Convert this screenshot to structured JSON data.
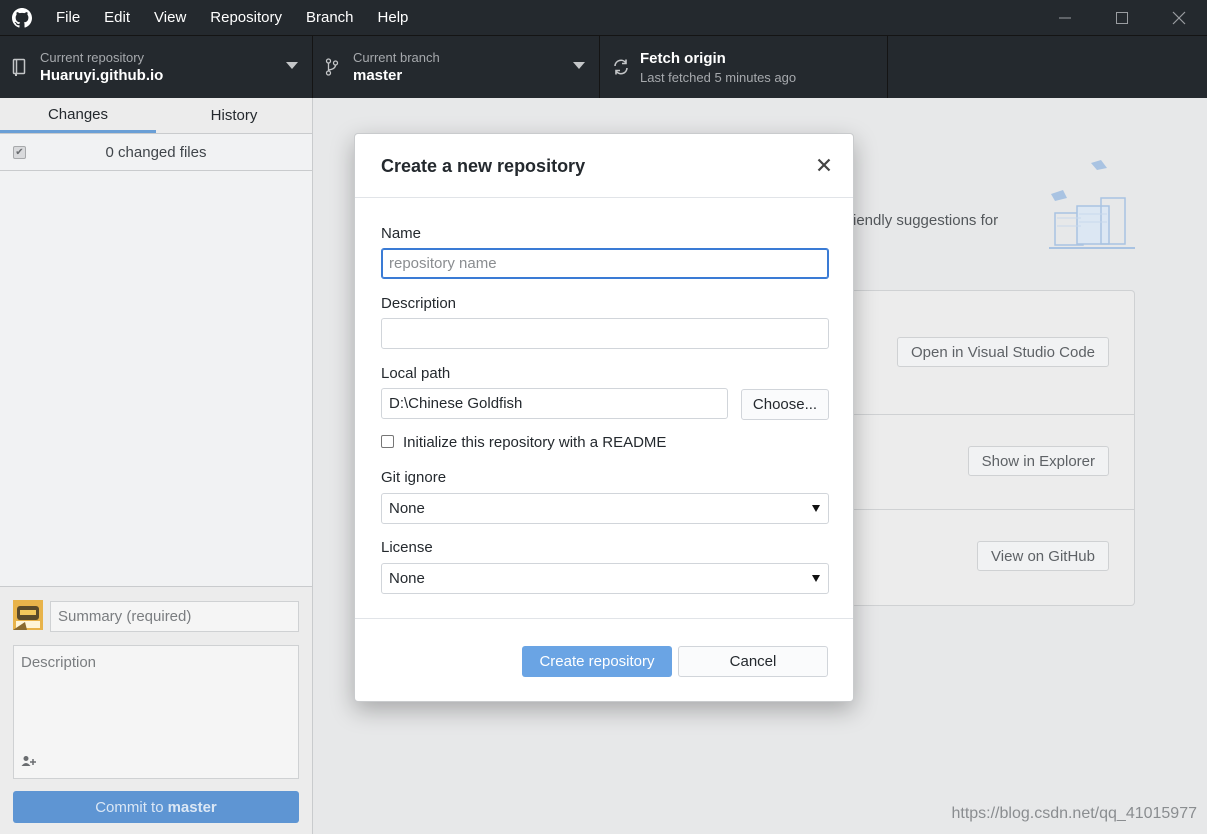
{
  "app": {
    "logo_icon": "github-octocat-icon"
  },
  "menu": [
    "File",
    "Edit",
    "View",
    "Repository",
    "Branch",
    "Help"
  ],
  "window_controls": {
    "minimize_icon": "minimize-icon",
    "maximize_icon": "maximize-icon",
    "close_icon": "close-icon"
  },
  "toolbar": {
    "repo": {
      "label": "Current repository",
      "value": "Huaruyi.github.io"
    },
    "branch": {
      "label": "Current branch",
      "value": "master"
    },
    "fetch": {
      "title": "Fetch origin",
      "subtitle": "Last fetched 5 minutes ago"
    }
  },
  "sidebar": {
    "tabs": [
      {
        "label": "Changes",
        "active": true
      },
      {
        "label": "History",
        "active": false
      }
    ],
    "changes_count": "0 changed files",
    "summary_placeholder": "Summary (required)",
    "description_placeholder": "Description",
    "commit_prefix": "Commit to",
    "commit_branch": "master"
  },
  "main": {
    "suggestions_text_partial": "iendly suggestions for",
    "actions": [
      "Open in Visual Studio Code",
      "Show in Explorer",
      "View on GitHub"
    ]
  },
  "dialog": {
    "title": "Create a new repository",
    "name_label": "Name",
    "name_placeholder": "repository name",
    "name_value": "",
    "description_label": "Description",
    "description_value": "",
    "local_path_label": "Local path",
    "local_path_value": "D:\\Chinese Goldfish",
    "choose_label": "Choose...",
    "readme_label": "Initialize this repository with a README",
    "readme_checked": false,
    "gitignore_label": "Git ignore",
    "gitignore_value": "None",
    "license_label": "License",
    "license_value": "None",
    "create_label": "Create repository",
    "cancel_label": "Cancel"
  },
  "watermark": "https://blog.csdn.net/qq_41015977",
  "colors": {
    "accent": "#6aa4e4",
    "chrome": "#24292e",
    "commit_button": "#5e95d3"
  }
}
